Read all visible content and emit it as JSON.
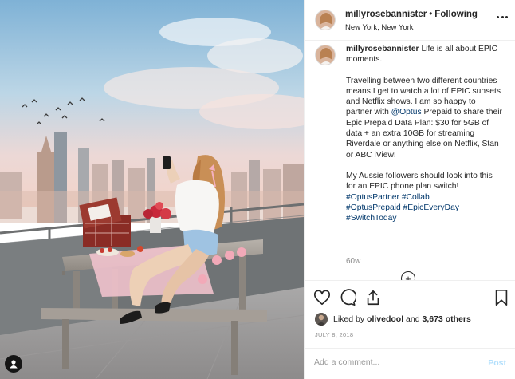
{
  "post": {
    "username": "millyrosebannister",
    "follow_status": "Following",
    "location": "New York, New York",
    "caption": {
      "username": "millyrosebannister",
      "line1": "Life is all about EPIC moments.",
      "para2_a": "Travelling between two different countries means I get to watch a lot of EPIC sunsets and Netflix shows. I am so happy to partner with ",
      "mention": "@Optus",
      "para2_b": " Prepaid to share their Epic Prepaid Data Plan: $30 for 5GB of data + an extra 10GB for streaming Riverdale or anything else on Netflix, Stan or ABC iView!",
      "para3": "My Aussie followers should look into this for an EPIC phone plan switch!",
      "hashtags": [
        "#OptusPartner",
        "#Collab",
        "#OptusPrepaid",
        "#EpicEveryDay",
        "#SwitchToday"
      ]
    },
    "time_ago": "60w",
    "likes": {
      "prefix": "Liked by",
      "user": "olivedool",
      "connector": "and",
      "count": "3,673 others"
    },
    "date": "JULY 8, 2018",
    "comment": {
      "placeholder": "Add a comment...",
      "post_label": "Post"
    }
  },
  "icons": {
    "more": "more-options-icon",
    "heart": "heart-icon",
    "comment": "comment-icon",
    "share": "share-icon",
    "save": "bookmark-icon",
    "user_tag": "user-tag-icon",
    "load_more": "plus-circle-icon"
  },
  "colors": {
    "link": "#00376b",
    "post_button_disabled": "#b2dffc",
    "muted": "#8e8e8e",
    "border": "#efefef"
  }
}
